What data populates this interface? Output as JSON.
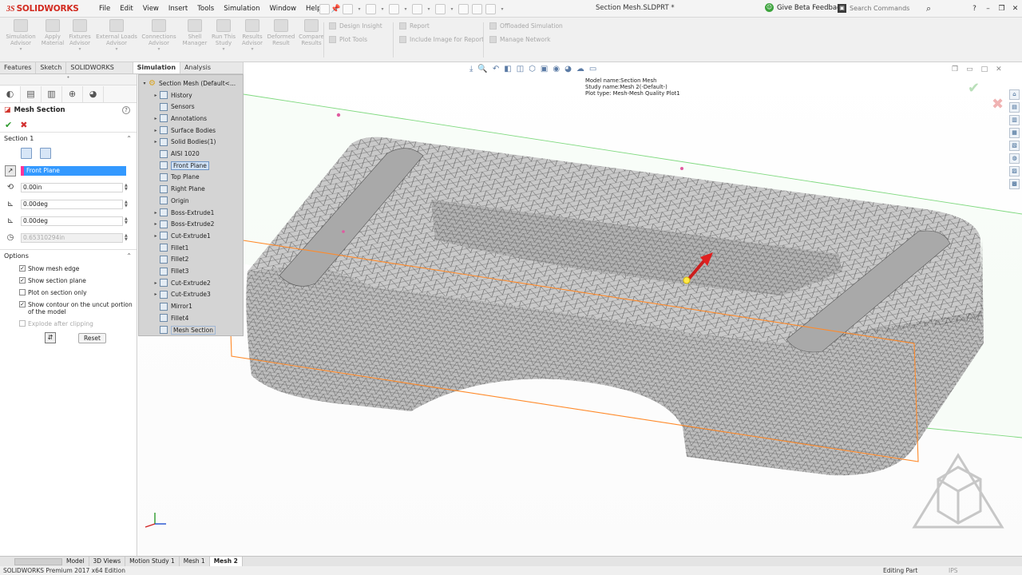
{
  "app": {
    "brand_ds": "3S",
    "brand_name": "SOLIDWORKS",
    "doc_title": "Section Mesh.SLDPRT *",
    "beta_feedback": "Give Beta Feedback",
    "search_placeholder": "Search Commands"
  },
  "menu": [
    "File",
    "Edit",
    "View",
    "Insert",
    "Tools",
    "Simulation",
    "Window",
    "Help"
  ],
  "ribbon": {
    "buttons": [
      {
        "label": "Simulation Advisor"
      },
      {
        "label": "Apply Material"
      },
      {
        "label": "Fixtures Advisor"
      },
      {
        "label": "External Loads Advisor"
      },
      {
        "label": "Connections Advisor"
      },
      {
        "label": "Shell Manager"
      },
      {
        "label": "Run This Study"
      },
      {
        "label": "Results Advisor"
      },
      {
        "label": "Deformed Result"
      },
      {
        "label": "Compare Results"
      }
    ],
    "small": {
      "design_insight": "Design Insight",
      "plot_tools": "Plot Tools",
      "report": "Report",
      "include_image": "Include Image for Report",
      "offloaded": "Offloaded Simulation",
      "manage_network": "Manage Network"
    }
  },
  "cm_tabs": [
    "Features",
    "Sketch",
    "SOLIDWORKS Add-Ins",
    "Simulation",
    "Analysis Preparation"
  ],
  "property_manager": {
    "title": "Mesh Section",
    "section_label": "Section 1",
    "plane_value": "Front Plane",
    "offset_value": "0.00in",
    "angle1_value": "0.00deg",
    "angle2_value": "0.00deg",
    "thickness_value": "0.65310294in",
    "options_label": "Options",
    "options": [
      {
        "label": "Show mesh edge",
        "checked": true,
        "enabled": true
      },
      {
        "label": "Show section plane",
        "checked": true,
        "enabled": true
      },
      {
        "label": "Plot on section only",
        "checked": false,
        "enabled": true
      },
      {
        "label": "Show contour on the uncut portion of the model",
        "checked": true,
        "enabled": true
      },
      {
        "label": "Explode after clipping",
        "checked": false,
        "enabled": false
      }
    ],
    "reset_label": "Reset"
  },
  "tree": {
    "root": "Section Mesh  (Default<...",
    "items": [
      {
        "label": "History",
        "expand": true
      },
      {
        "label": "Sensors",
        "expand": false
      },
      {
        "label": "Annotations",
        "expand": true
      },
      {
        "label": "Surface Bodies",
        "expand": true
      },
      {
        "label": "Solid Bodies(1)",
        "expand": true
      },
      {
        "label": "AISI 1020",
        "expand": false
      },
      {
        "label": "Front Plane",
        "expand": false
      },
      {
        "label": "Top Plane",
        "expand": false
      },
      {
        "label": "Right Plane",
        "expand": false
      },
      {
        "label": "Origin",
        "expand": false
      },
      {
        "label": "Boss-Extrude1",
        "expand": true
      },
      {
        "label": "Boss-Extrude2",
        "expand": true
      },
      {
        "label": "Cut-Extrude1",
        "expand": true
      },
      {
        "label": "Fillet1",
        "expand": false
      },
      {
        "label": "Fillet2",
        "expand": false
      },
      {
        "label": "Fillet3",
        "expand": false
      },
      {
        "label": "Cut-Extrude2",
        "expand": true
      },
      {
        "label": "Cut-Extrude3",
        "expand": true
      },
      {
        "label": "Mirror1",
        "expand": false
      },
      {
        "label": "Fillet4",
        "expand": false
      },
      {
        "label": "Mesh Section",
        "expand": false
      }
    ]
  },
  "plot_info": {
    "line1": "Model name:Section Mesh",
    "line2": "Study name:Mesh 2(-Default-)",
    "line3": "Plot type: Mesh-Mesh Quality Plot1"
  },
  "bottom_tabs": [
    "Model",
    "3D Views",
    "Motion Study 1",
    "Mesh 1",
    "Mesh 2"
  ],
  "status": {
    "edition": "SOLIDWORKS Premium 2017 x64 Edition",
    "mode": "Editing Part",
    "units": "IPS"
  },
  "colors": {
    "accent": "#d22a1f",
    "selection": "#3399ff",
    "section_plane": "#ff8a2a",
    "green_plane": "#7fd97f"
  }
}
